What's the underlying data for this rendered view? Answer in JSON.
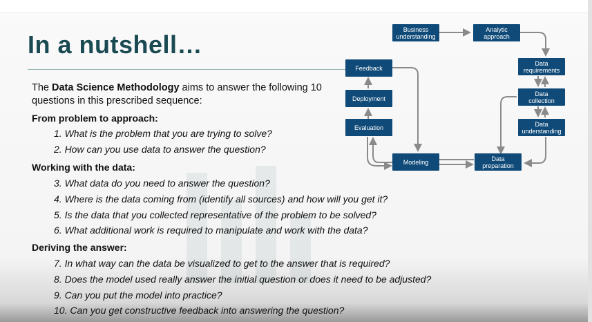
{
  "title": "In a nutshell…",
  "intro": {
    "prefix": "The ",
    "emphasis": "Data Science Methodology",
    "suffix": " aims to answer the following 10 questions in this prescribed sequence:"
  },
  "sections": [
    {
      "heading": "From problem to approach:",
      "questions": [
        "1. What is the problem that you are trying to solve?",
        "2. How can you use data to answer the question?"
      ]
    },
    {
      "heading": "Working with the data:",
      "questions": [
        "3. What data do you need to answer the question?",
        "4. Where is the data coming from (identify all sources) and how will you get it?",
        "5. Is the data that you collected representative of the problem to be solved?",
        "6. What additional work is required to manipulate and work with the data?"
      ]
    },
    {
      "heading": "Deriving the answer:",
      "questions": [
        "7. In what way can the data be visualized to get to the answer that is required?",
        "8. Does the model used really answer the initial question or does it need to be adjusted?",
        "9. Can you put the model into practice?",
        "10. Can you get constructive feedback into answering the question?"
      ]
    }
  ],
  "diagram": {
    "nodes": {
      "business": [
        "Business",
        "understanding"
      ],
      "analytic": [
        "Analytic",
        "approach"
      ],
      "requirements": [
        "Data",
        "requirements"
      ],
      "collection": [
        "Data",
        "collection"
      ],
      "understanding": [
        "Data",
        "understanding"
      ],
      "preparation": [
        "Data",
        "preparation"
      ],
      "modeling": [
        "Modeling"
      ],
      "evaluation": [
        "Evaluation"
      ],
      "deployment": [
        "Deployment"
      ],
      "feedback": [
        "Feedback"
      ]
    },
    "box_color": "#0f4a78",
    "arrow_color": "#8a8a8a"
  },
  "colors": {
    "title": "#1a4a52",
    "rule": "#8fb3b1"
  }
}
